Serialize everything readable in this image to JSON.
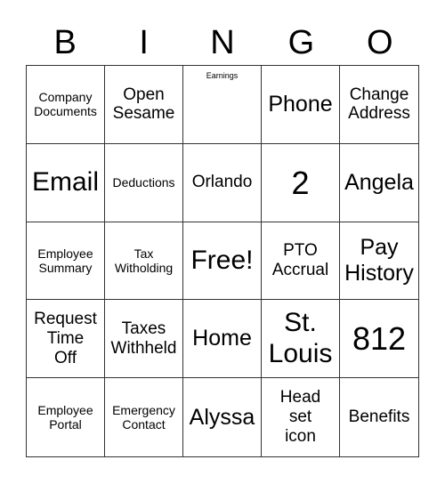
{
  "header": {
    "letters": [
      "B",
      "I",
      "N",
      "G",
      "O"
    ]
  },
  "cells": [
    {
      "text": "Company\nDocuments",
      "size": "s-sm"
    },
    {
      "text": "Open\nSesame",
      "size": "s-md"
    },
    {
      "text": "Earnings",
      "size": "s-xs"
    },
    {
      "text": "Phone",
      "size": "s-lg"
    },
    {
      "text": "Change\nAddress",
      "size": "s-md"
    },
    {
      "text": "Email",
      "size": "s-xl"
    },
    {
      "text": "Deductions",
      "size": "s-sm"
    },
    {
      "text": "Orlando",
      "size": "s-md"
    },
    {
      "text": "2",
      "size": "s-xxl"
    },
    {
      "text": "Angela",
      "size": "s-lg"
    },
    {
      "text": "Employee\nSummary",
      "size": "s-sm"
    },
    {
      "text": "Tax\nWitholding",
      "size": "s-sm"
    },
    {
      "text": "Free!",
      "size": "s-xl"
    },
    {
      "text": "PTO\nAccrual",
      "size": "s-md"
    },
    {
      "text": "Pay\nHistory",
      "size": "s-lg"
    },
    {
      "text": "Request\nTime\nOff",
      "size": "s-md"
    },
    {
      "text": "Taxes\nWithheld",
      "size": "s-md"
    },
    {
      "text": "Home",
      "size": "s-lg"
    },
    {
      "text": "St.\nLouis",
      "size": "s-xl"
    },
    {
      "text": "812",
      "size": "s-xxl"
    },
    {
      "text": "Employee\nPortal",
      "size": "s-sm"
    },
    {
      "text": "Emergency\nContact",
      "size": "s-sm"
    },
    {
      "text": "Alyssa",
      "size": "s-lg"
    },
    {
      "text": "Head\nset\nicon",
      "size": "s-md"
    },
    {
      "text": "Benefits",
      "size": "s-md"
    }
  ]
}
